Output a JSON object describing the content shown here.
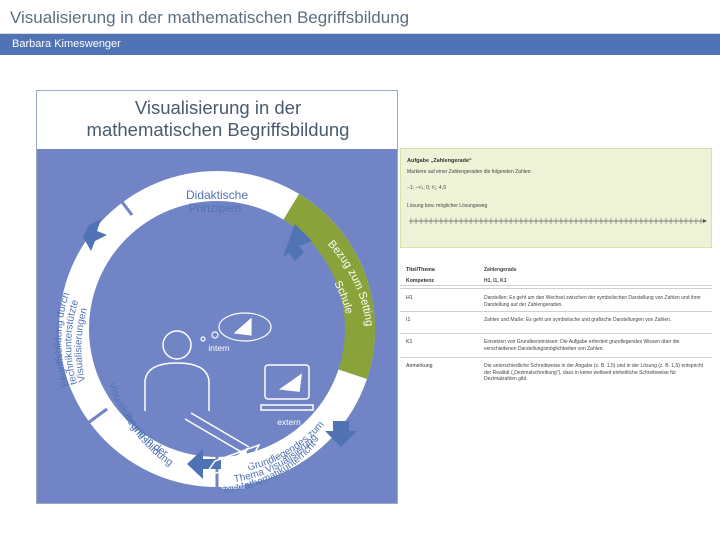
{
  "slide": {
    "title": "Visualisierung in der mathematischen Begriffsbildung",
    "author": "Barbara Kimeswenger"
  },
  "figure": {
    "title_line1": "Visualisierung in der",
    "title_line2": "mathematischen Begriffsbildung",
    "segments": {
      "top_line1": "Didaktische",
      "top_line2": "Prinzipien",
      "right_line1": "Bezug zum Setting",
      "right_line2": "Schule",
      "bottom_right_line1": "Grundlegendes zum",
      "bottom_right_line2": "Thema Visualisierung",
      "bottom_right_line3": "im Mathematikunterricht",
      "bottom_left_line1": "Visualisierung in der",
      "bottom_left_line2": "Begriffsbildung",
      "left_line1": "Begriffsbildung durch",
      "left_line2": "technikunterstützte",
      "left_line3": "Visualisierungen"
    },
    "labels": {
      "intern": "intern",
      "extern_screen": "extern",
      "extern_paper": "extern"
    },
    "colors": {
      "ring_blue": "#7185c6",
      "ring_green": "#8aa23a",
      "inner_white": "#ffffff",
      "text_blue": "#4f73b4"
    }
  },
  "task": {
    "title": "Aufgabe „Zahlengerade“",
    "instruction": "Markiere auf einer Zahlengeraden die folgenden Zahlen:",
    "numbers": "−1; −⁵⁄₄; 0; ³⁄₂; 4,9",
    "solution_label": "Lösung bzw. möglicher Lösungsweg"
  },
  "info": {
    "rows": [
      {
        "k": "Titel/Thema",
        "v": "Zahlengerade"
      },
      {
        "k": "Kompetenz",
        "v": "H1, I1, K1"
      },
      {
        "k": "H1",
        "v": "Darstellen: Es geht um den Wechsel zwischen der symbolischen Darstellung von Zahlen und ihrer Darstellung auf der Zahlengeraden."
      },
      {
        "k": "I1",
        "v": "Zahlen und Maße: Es geht um symbolische und grafische Darstellungen von Zahlen."
      },
      {
        "k": "K1",
        "v": "Einsetzen von Grundkenntnissen: Die Aufgabe erfordert grundlegendes Wissen über die verschiedenen Darstellungsmöglichkeiten von Zahlen."
      },
      {
        "k": "Anmerkung",
        "v": "Die unterschiedliche Schreibweise in der Angabe (z. B. 1,5) und in der Lösung (z. B. 1,5) entspricht der Realität („Dezimalschreibung“), dass in keine weltweit einheitliche Schreibweise für Dezimalzahlen gibt."
      }
    ]
  }
}
